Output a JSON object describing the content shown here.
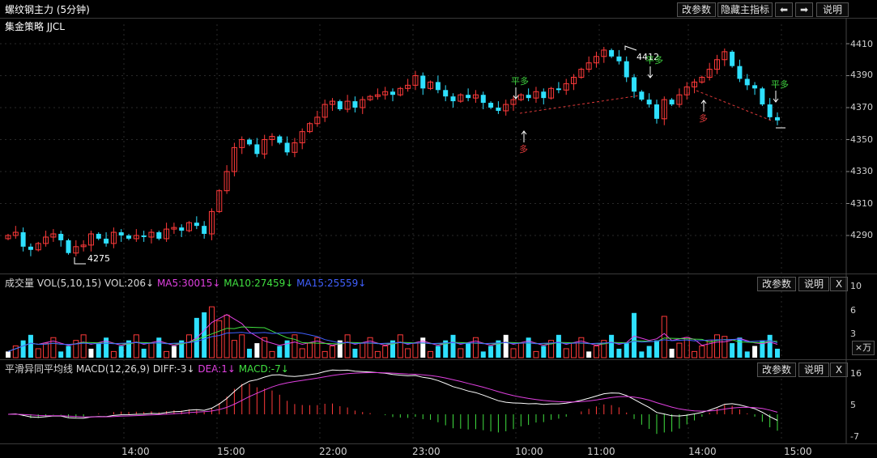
{
  "header": {
    "title": "螺纹钢主力 (5分钟)",
    "buttons": [
      "改参数",
      "隐藏主指标",
      "⬅",
      "➡",
      "说明"
    ]
  },
  "main_panel": {
    "strategy": "集金策略 JJCL",
    "y_ticks": [
      "4410",
      "4390",
      "4370",
      "4350",
      "4330",
      "4310",
      "4290"
    ],
    "low_label": "4275",
    "high_label": "4412",
    "signals": [
      {
        "text": "平多",
        "color": "#3ecf3e"
      },
      {
        "text": "多",
        "color": "#e03a3a"
      },
      {
        "text": "平多",
        "color": "#3ecf3e"
      },
      {
        "text": "多",
        "color": "#e03a3a"
      },
      {
        "text": "平多",
        "color": "#3ecf3e"
      }
    ]
  },
  "volume_panel": {
    "name": "成交量",
    "indicator": "VOL(5,10,15)",
    "vol": "VOL:206↓",
    "ma5": "MA5:30015↓",
    "ma10": "MA10:27459↓",
    "ma15": "MA15:25559↓",
    "buttons": [
      "改参数",
      "说明",
      "X"
    ],
    "y_ticks": [
      "10",
      "6",
      "3"
    ],
    "unit": "×万",
    "colors": {
      "ma5": "#e040e0",
      "ma10": "#40e040",
      "ma15": "#4060ff"
    }
  },
  "macd_panel": {
    "name": "平滑异同平均线",
    "indicator": "MACD(12,26,9)",
    "diff": "DIFF:-3↓",
    "dea": "DEA:1↓",
    "macd": "MACD:-7↓",
    "buttons": [
      "改参数",
      "说明",
      "X"
    ],
    "y_ticks": [
      "16",
      "5",
      "-7"
    ],
    "colors": {
      "diff": "#ffffff",
      "dea": "#e040e0",
      "macd": "#40e040"
    }
  },
  "x_axis": {
    "labels": [
      "14:00",
      "15:00",
      "22:00",
      "23:00",
      "10:00",
      "11:00",
      "14:00",
      "15:00"
    ]
  },
  "chart_data": {
    "type": "candlestick",
    "series": [
      {
        "name": "K",
        "y_range": [
          4270,
          4420
        ]
      },
      {
        "name": "成交量",
        "y_range": [
          0,
          10.5
        ]
      },
      {
        "name": "MACD",
        "y_range": [
          -9,
          18
        ]
      }
    ]
  }
}
